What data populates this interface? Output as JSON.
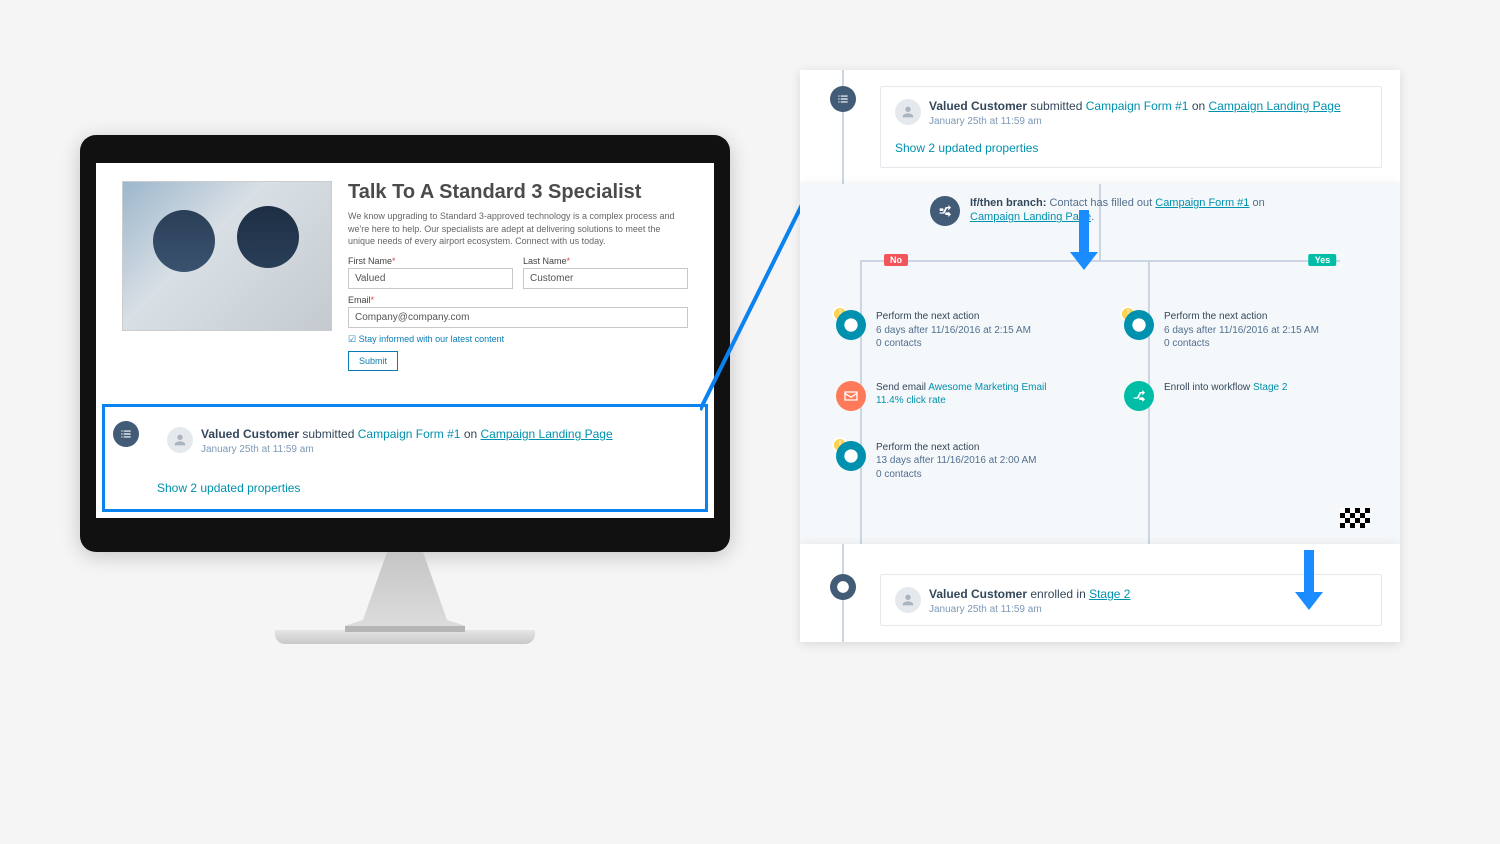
{
  "landing": {
    "title": "Talk To A Standard 3 Specialist",
    "desc": "We know upgrading to Standard 3-approved technology is a complex process and we're here to help. Our specialists are adept at delivering solutions to meet the unique needs of every airport ecosystem. Connect with us today.",
    "first_name_label": "First Name",
    "last_name_label": "Last Name",
    "email_label": "Email",
    "first_name_value": "Valued",
    "last_name_value": "Customer",
    "email_value": "Company@company.com",
    "checkbox_label": "Stay informed with our latest content",
    "submit_label": "Submit"
  },
  "activity1": {
    "name": "Valued Customer",
    "verb": "submitted",
    "form": "Campaign Form #1",
    "on": "on",
    "page": "Campaign Landing Page",
    "time": "January 25th at 11:59 am",
    "toggle": "Show 2 updated properties"
  },
  "workflow": {
    "branch_label": "If/then branch:",
    "branch_text": "Contact has filled out",
    "form": "Campaign Form #1",
    "on": "on",
    "page": "Campaign Landing Page",
    "no_badge": "No",
    "yes_badge": "Yes",
    "no_steps": [
      {
        "title": "Perform the next action",
        "line2": "6 days after 11/16/2016 at 2:15 AM",
        "line3": "0 contacts"
      },
      {
        "title": "Send email",
        "link": "Awesome Marketing Email",
        "line2": "11.4% click rate"
      },
      {
        "title": "Perform the next action",
        "line2": "13 days after 11/16/2016 at 2:00 AM",
        "line3": "0 contacts"
      }
    ],
    "yes_steps": [
      {
        "title": "Perform the next action",
        "line2": "6 days after 11/16/2016 at 2:15 AM",
        "line3": "0 contacts"
      },
      {
        "title": "Enroll into workflow",
        "link": "Stage 2"
      }
    ]
  },
  "activity2": {
    "name": "Valued Customer",
    "verb": "enrolled in",
    "link": "Stage 2",
    "time": "January 25th at 11:59 am"
  }
}
